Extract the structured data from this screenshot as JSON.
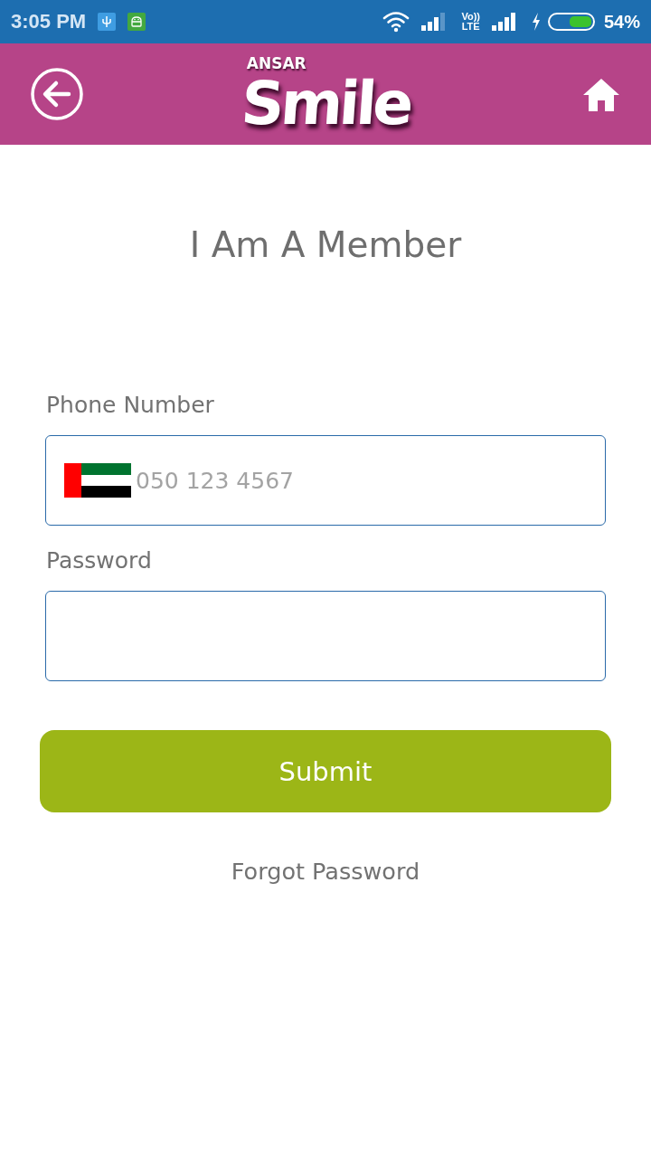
{
  "status_bar": {
    "time": "3:05 PM",
    "network_type": [
      "Vo))",
      "LTE"
    ],
    "battery_percent": "54%"
  },
  "header": {
    "logo": {
      "brand": "ANSAR",
      "name": "Smile"
    }
  },
  "title": "I Am A Member",
  "form": {
    "fields": [
      {
        "kind": "phone",
        "label": "Phone Number",
        "placeholder": "050 123 4567"
      },
      {
        "kind": "password",
        "label": "Password"
      }
    ],
    "submit": "Submit",
    "forgot_password": "Forgot Password"
  }
}
